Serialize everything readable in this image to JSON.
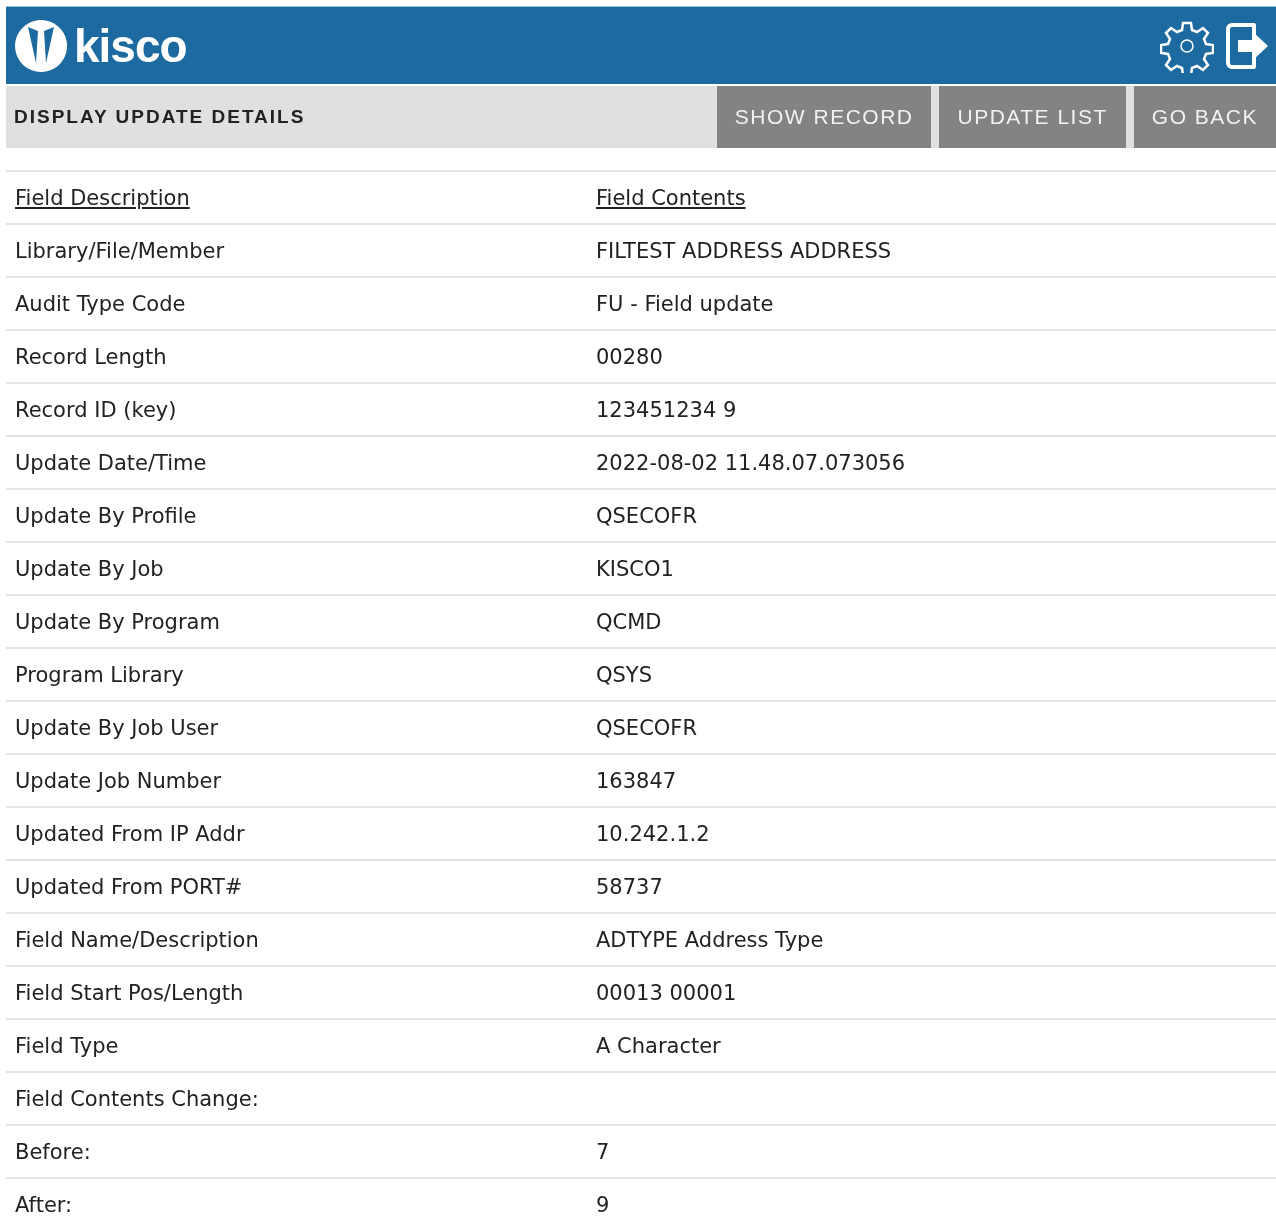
{
  "header": {
    "logo_text": "kisco"
  },
  "toolbar": {
    "title": "DISPLAY UPDATE DETAILS",
    "buttons": [
      "SHOW RECORD",
      "UPDATE LIST",
      "GO BACK"
    ]
  },
  "table": {
    "columns": [
      "Field Description",
      "Field Contents"
    ],
    "rows": [
      [
        "Library/File/Member",
        "FILTEST ADDRESS ADDRESS"
      ],
      [
        "Audit Type Code",
        "FU - Field update"
      ],
      [
        "Record Length",
        "00280"
      ],
      [
        "Record ID (key)",
        "123451234 9"
      ],
      [
        "Update Date/Time",
        "2022-08-02 11.48.07.073056"
      ],
      [
        "Update By Profile",
        "QSECOFR"
      ],
      [
        "Update By Job",
        "KISCO1"
      ],
      [
        "Update By Program",
        "QCMD"
      ],
      [
        "Program Library",
        "QSYS"
      ],
      [
        "Update By Job User",
        "QSECOFR"
      ],
      [
        "Update Job Number",
        "163847"
      ],
      [
        "Updated From IP Addr",
        "10.242.1.2"
      ],
      [
        "Updated From PORT#",
        "58737"
      ],
      [
        "Field Name/Description",
        "ADTYPE Address Type"
      ],
      [
        "Field Start Pos/Length",
        "00013 00001"
      ],
      [
        "Field Type",
        "A Character"
      ],
      [
        "Field Contents Change:",
        ""
      ],
      [
        "Before:",
        "7"
      ],
      [
        "After:",
        "9"
      ]
    ]
  }
}
